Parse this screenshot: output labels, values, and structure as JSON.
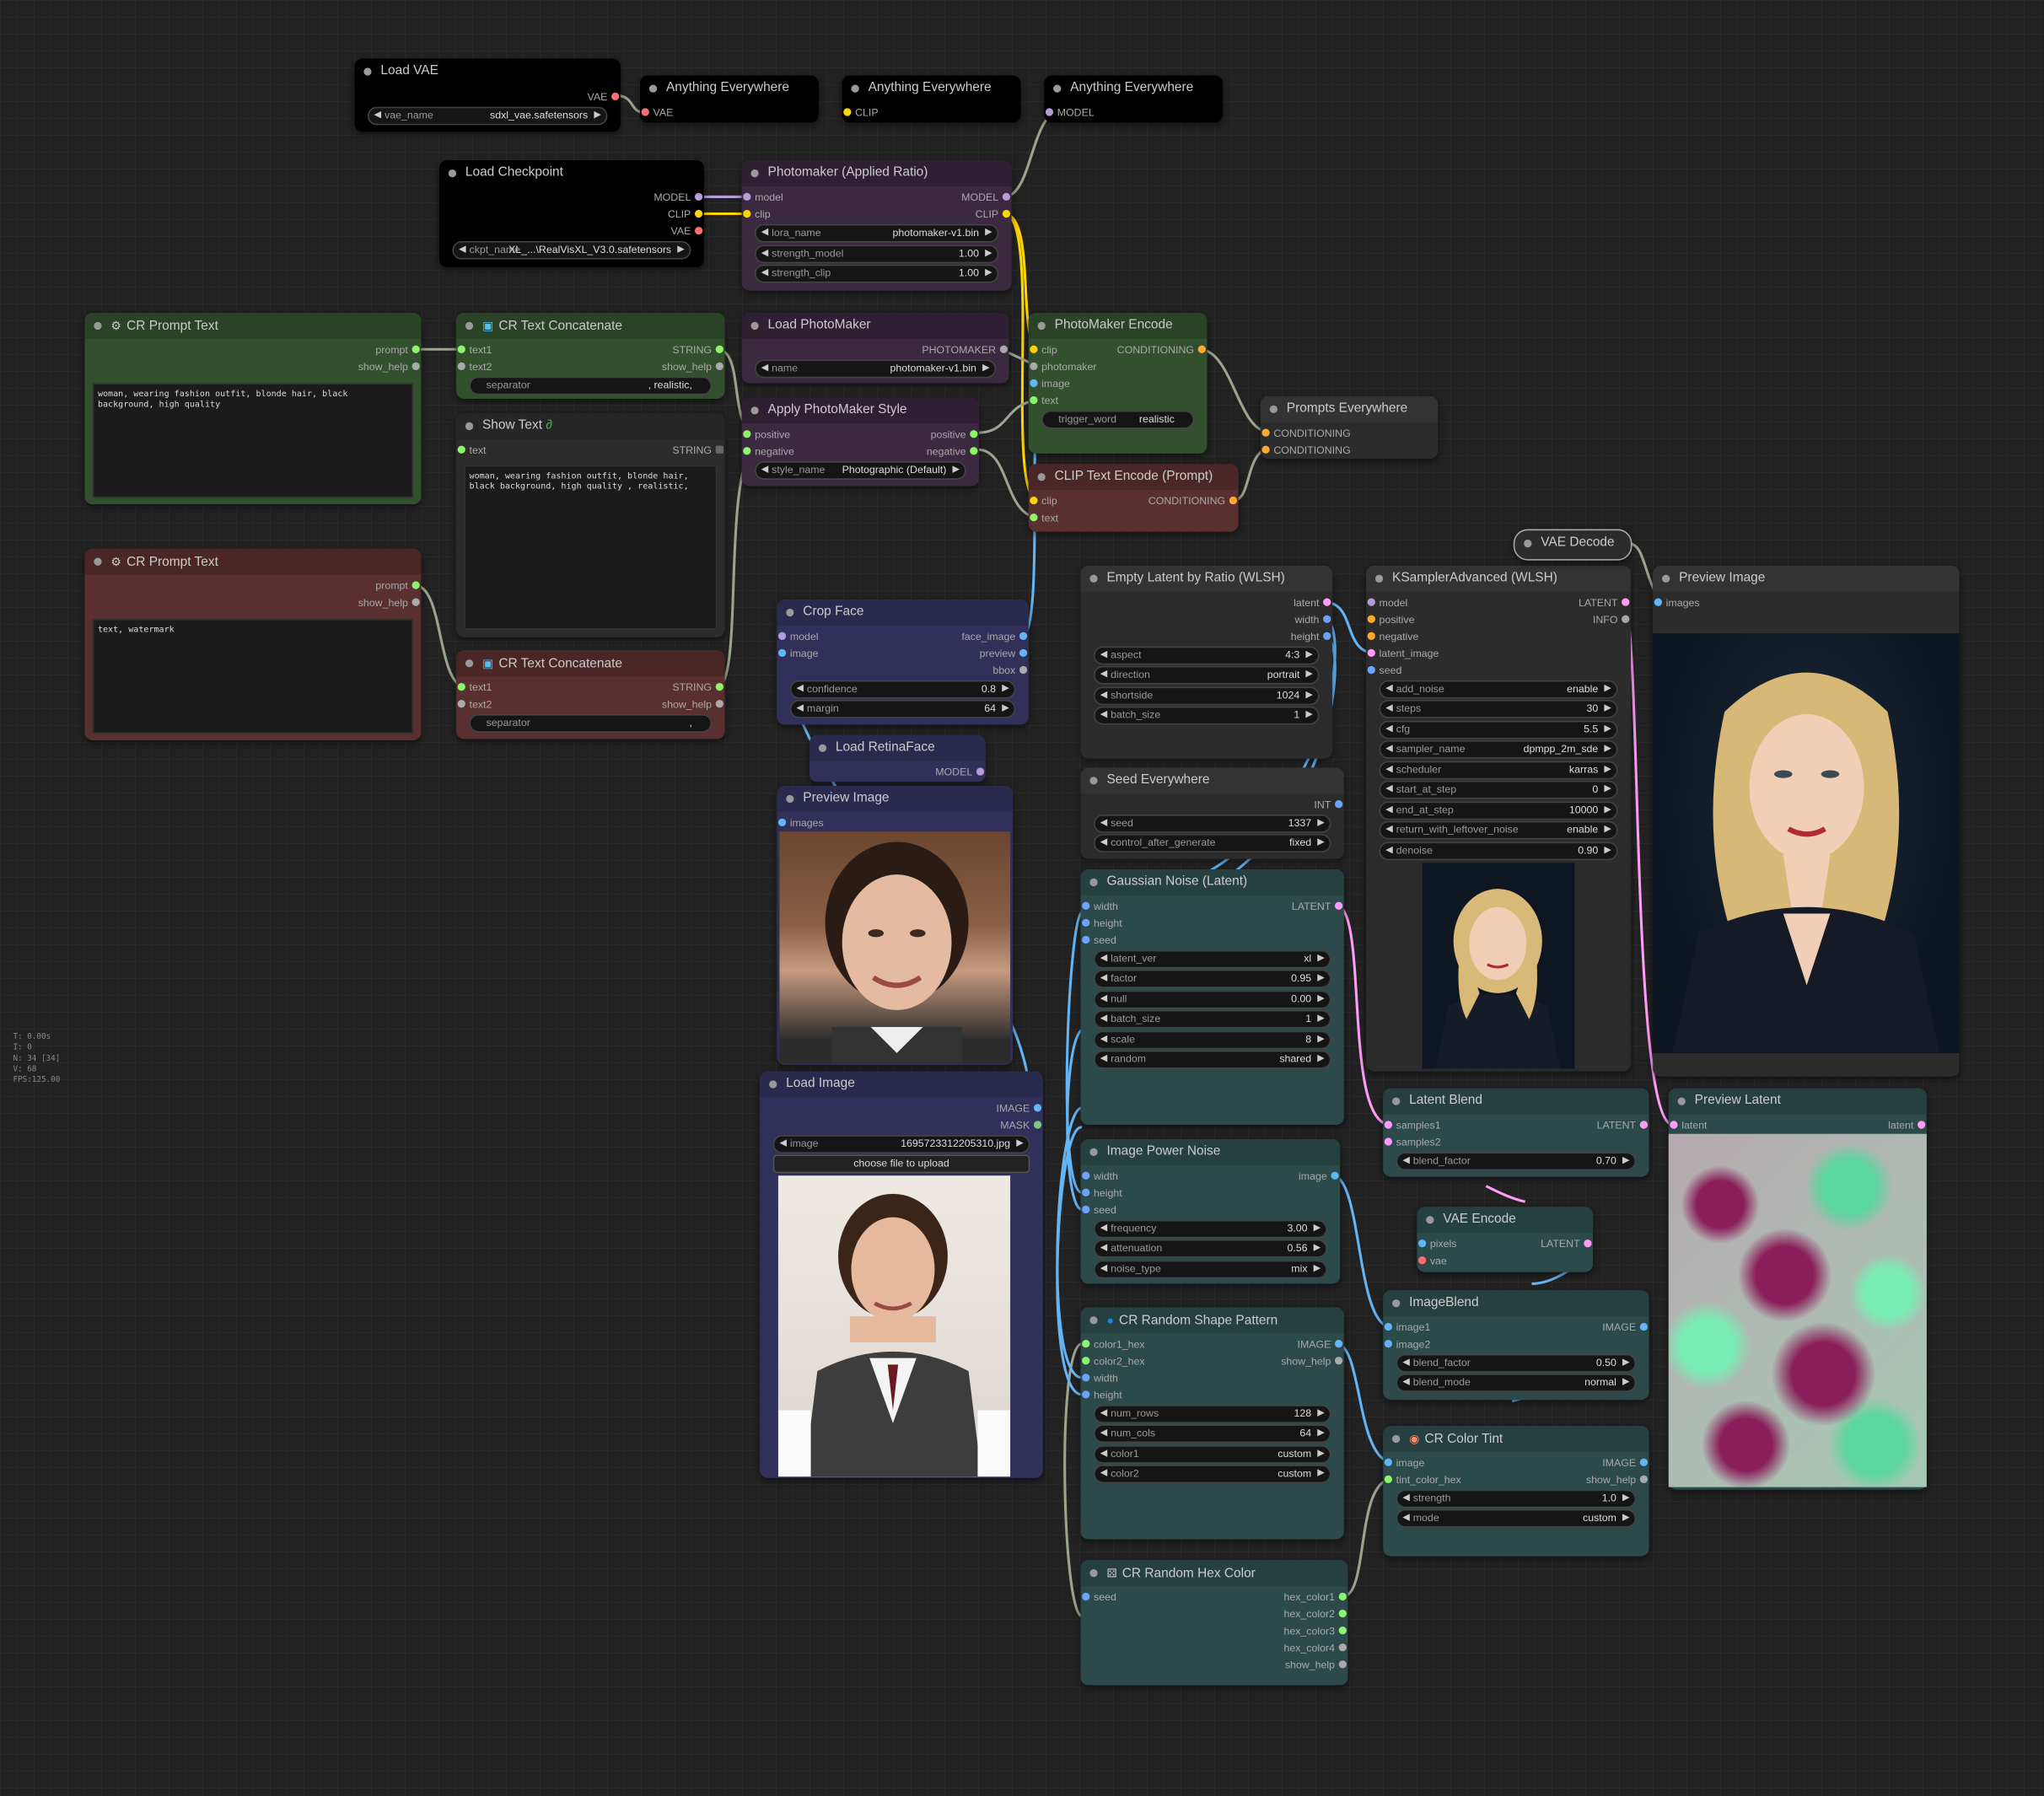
{
  "colors": {
    "model": "#b39ddb",
    "clip": "#ffd500",
    "vae": "#ff6e6e",
    "conditioning": "#ffa931",
    "latent": "#ff9cf9",
    "image": "#64b5f6",
    "string": "#8cf56b",
    "int": "#6ca3ff",
    "mask": "#81c784",
    "photomaker": "#aaaaaa",
    "background": "#222222"
  },
  "stats": {
    "time": "T: 0.00s",
    "i": "I: 0",
    "n": "N: 34 [34]",
    "v": "V: 68",
    "fps": "FPS:125.00"
  },
  "load_vae": {
    "title": "Load VAE",
    "out_vae": "VAE",
    "vae_name_label": "vae_name",
    "vae_name": "sdxl_vae.safetensors"
  },
  "ae_vae": {
    "title": "Anything Everywhere",
    "in": "VAE"
  },
  "ae_clip": {
    "title": "Anything Everywhere",
    "in": "CLIP"
  },
  "ae_model": {
    "title": "Anything Everywhere",
    "in": "MODEL"
  },
  "load_checkpoint": {
    "title": "Load Checkpoint",
    "out_model": "MODEL",
    "out_clip": "CLIP",
    "out_vae": "VAE",
    "ckpt_label": "ckpt_name",
    "ckpt_value": "XL_...\\RealVisXL_V3.0.safetensors"
  },
  "photomaker_applied": {
    "title": "Photomaker (Applied Ratio)",
    "in_model": "model",
    "in_clip": "clip",
    "out_model": "MODEL",
    "out_clip": "CLIP",
    "lora_label": "lora_name",
    "lora_value": "photomaker-v1.bin",
    "sm_label": "strength_model",
    "sm_value": "1.00",
    "sc_label": "strength_clip",
    "sc_value": "1.00"
  },
  "cr_prompt_pos": {
    "title": "CR Prompt Text",
    "out_prompt": "prompt",
    "out_help": "show_help",
    "text": "woman, wearing fashion outfit, blonde hair, black background, high quality"
  },
  "cr_concat_1": {
    "title": "CR Text Concatenate",
    "in_text1": "text1",
    "in_text2": "text2",
    "out_string": "STRING",
    "out_help": "show_help",
    "sep_label": "separator",
    "sep_value": ", realistic,"
  },
  "show_text": {
    "title": "Show Text",
    "in_text": "text",
    "out_string": "STRING",
    "text": "woman, wearing fashion outfit, blonde hair, black background, high quality , realistic,"
  },
  "load_photomaker": {
    "title": "Load PhotoMaker",
    "out": "PHOTOMAKER",
    "name_label": "name",
    "name_value": "photomaker-v1.bin"
  },
  "apply_style": {
    "title": "Apply PhotoMaker Style",
    "in_pos": "positive",
    "in_neg": "negative",
    "out_pos": "positive",
    "out_neg": "negative",
    "style_label": "style_name",
    "style_value": "Photographic (Default)"
  },
  "photomaker_encode": {
    "title": "PhotoMaker Encode",
    "in_clip": "clip",
    "in_pm": "photomaker",
    "in_image": "image",
    "in_text": "text",
    "out": "CONDITIONING",
    "tw_label": "trigger_word",
    "tw_value": "realistic"
  },
  "prompts_everywhere": {
    "title": "Prompts Everywhere",
    "in1": "CONDITIONING",
    "in2": "CONDITIONING"
  },
  "clip_text_encode": {
    "title": "CLIP Text Encode (Prompt)",
    "in_clip": "clip",
    "in_text": "text",
    "out": "CONDITIONING"
  },
  "cr_prompt_neg": {
    "title": "CR Prompt Text",
    "out_prompt": "prompt",
    "out_help": "show_help",
    "text": "text, watermark"
  },
  "cr_concat_2": {
    "title": "CR Text Concatenate",
    "in_text1": "text1",
    "in_text2": "text2",
    "out_string": "STRING",
    "out_help": "show_help",
    "sep_label": "separator",
    "sep_value": ","
  },
  "crop_face": {
    "title": "Crop Face",
    "in_model": "model",
    "in_image": "image",
    "out_face": "face_image",
    "out_preview": "preview",
    "out_bbox": "bbox",
    "conf_label": "confidence",
    "conf_value": "0.8",
    "margin_label": "margin",
    "margin_value": "64"
  },
  "load_retinaface": {
    "title": "Load RetinaFace",
    "out": "MODEL"
  },
  "preview_face": {
    "title": "Preview Image",
    "in": "images"
  },
  "load_image": {
    "title": "Load Image",
    "out_image": "IMAGE",
    "out_mask": "MASK",
    "image_label": "image",
    "image_value": "1695723312205310.jpg",
    "upload": "choose file to upload"
  },
  "empty_latent": {
    "title": "Empty Latent by Ratio (WLSH)",
    "out_latent": "latent",
    "out_width": "width",
    "out_height": "height",
    "aspect_label": "aspect",
    "aspect_value": "4:3",
    "dir_label": "direction",
    "dir_value": "portrait",
    "short_label": "shortside",
    "short_value": "1024",
    "batch_label": "batch_size",
    "batch_value": "1"
  },
  "seed_everywhere": {
    "title": "Seed Everywhere",
    "out": "INT",
    "seed_label": "seed",
    "seed_value": "1337",
    "ctrl_label": "control_after_generate",
    "ctrl_value": "fixed"
  },
  "gaussian_noise": {
    "title": "Gaussian Noise (Latent)",
    "in_width": "width",
    "in_height": "height",
    "in_seed": "seed",
    "out": "LATENT",
    "widgets": [
      {
        "label": "latent_ver",
        "value": "xl"
      },
      {
        "label": "factor",
        "value": "0.95"
      },
      {
        "label": "null",
        "value": "0.00"
      },
      {
        "label": "batch_size",
        "value": "1"
      },
      {
        "label": "scale",
        "value": "8"
      },
      {
        "label": "random",
        "value": "shared"
      }
    ]
  },
  "ksampler": {
    "title": "KSamplerAdvanced (WLSH)",
    "in_model": "model",
    "in_pos": "positive",
    "in_neg": "negative",
    "in_latent": "latent_image",
    "in_seed": "seed",
    "out_latent": "LATENT",
    "out_info": "INFO",
    "widgets": [
      {
        "label": "add_noise",
        "value": "enable"
      },
      {
        "label": "steps",
        "value": "30"
      },
      {
        "label": "cfg",
        "value": "5.5"
      },
      {
        "label": "sampler_name",
        "value": "dpmpp_2m_sde"
      },
      {
        "label": "scheduler",
        "value": "karras"
      },
      {
        "label": "start_at_step",
        "value": "0"
      },
      {
        "label": "end_at_step",
        "value": "10000"
      },
      {
        "label": "return_with_leftover_noise",
        "value": "enable"
      },
      {
        "label": "denoise",
        "value": "0.90"
      }
    ]
  },
  "vae_decode": {
    "title": "VAE Decode"
  },
  "preview_main": {
    "title": "Preview Image",
    "in": "images"
  },
  "image_power_noise": {
    "title": "Image Power Noise",
    "in_width": "width",
    "in_height": "height",
    "in_seed": "seed",
    "out": "image",
    "widgets": [
      {
        "label": "frequency",
        "value": "3.00"
      },
      {
        "label": "attenuation",
        "value": "0.56"
      },
      {
        "label": "noise_type",
        "value": "mix"
      }
    ]
  },
  "latent_blend": {
    "title": "Latent Blend",
    "in1": "samples1",
    "in2": "samples2",
    "out": "LATENT",
    "bf_label": "blend_factor",
    "bf_value": "0.70"
  },
  "preview_latent": {
    "title": "Preview Latent",
    "in": "latent",
    "out": "latent"
  },
  "vae_encode": {
    "title": "VAE Encode",
    "in_pixels": "pixels",
    "in_vae": "vae",
    "out": "LATENT"
  },
  "image_blend": {
    "title": "ImageBlend",
    "in1": "image1",
    "in2": "image2",
    "out": "IMAGE",
    "bf_label": "blend_factor",
    "bf_value": "0.50",
    "bm_label": "blend_mode",
    "bm_value": "normal"
  },
  "cr_random_shape": {
    "title": "CR Random Shape Pattern",
    "in_c1": "color1_hex",
    "in_c2": "color2_hex",
    "in_w": "width",
    "in_h": "height",
    "out_image": "IMAGE",
    "out_help": "show_help",
    "widgets": [
      {
        "label": "num_rows",
        "value": "128"
      },
      {
        "label": "num_cols",
        "value": "64"
      },
      {
        "label": "color1",
        "value": "custom"
      },
      {
        "label": "color2",
        "value": "custom"
      }
    ]
  },
  "cr_color_tint": {
    "title": "CR Color Tint",
    "in_image": "image",
    "in_tint": "tint_color_hex",
    "out_image": "IMAGE",
    "out_help": "show_help",
    "st_label": "strength",
    "st_value": "1.0",
    "mode_label": "mode",
    "mode_value": "custom"
  },
  "cr_random_hex": {
    "title": "CR Random Hex Color",
    "in_seed": "seed",
    "outs": [
      "hex_color1",
      "hex_color2",
      "hex_color3",
      "hex_color4",
      "show_help"
    ]
  }
}
